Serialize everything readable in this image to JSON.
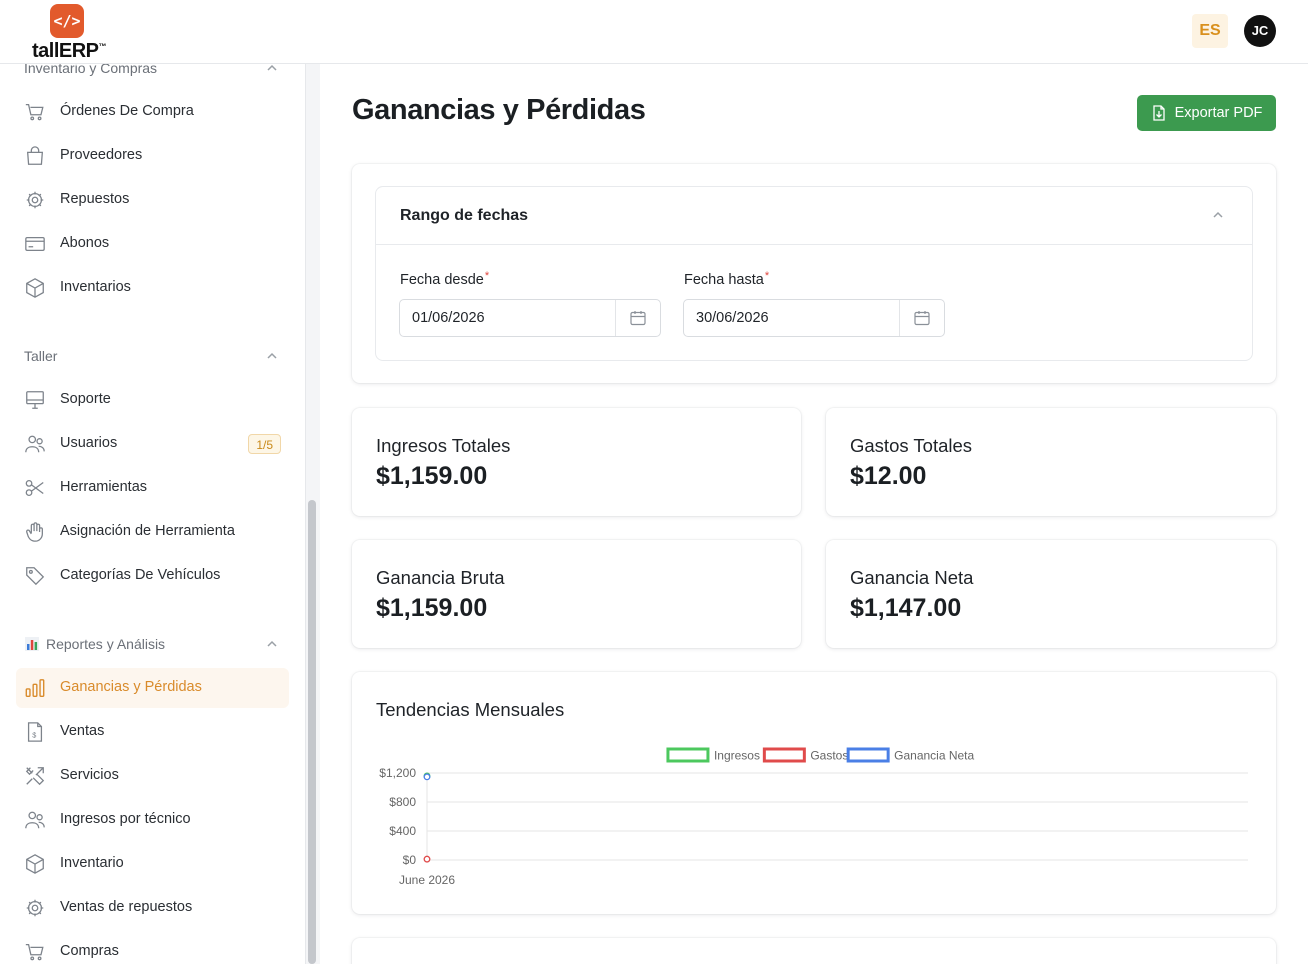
{
  "app": {
    "logo_text": "tallERP",
    "logo_tm": "™",
    "logo_mark": "</>",
    "language": "ES",
    "user_initials": "JC"
  },
  "sidebar": {
    "sections": [
      {
        "title": "Inventario y Compras",
        "items": [
          {
            "label": "Órdenes De Compra",
            "icon": "cart-icon"
          },
          {
            "label": "Proveedores",
            "icon": "shopping-bag-icon"
          },
          {
            "label": "Repuestos",
            "icon": "gear-icon"
          },
          {
            "label": "Abonos",
            "icon": "credit-card-icon"
          },
          {
            "label": "Inventarios",
            "icon": "box-icon"
          }
        ]
      },
      {
        "title": "Taller",
        "items": [
          {
            "label": "Soporte",
            "icon": "monitor-icon"
          },
          {
            "label": "Usuarios",
            "icon": "users-icon",
            "badge": "1/5"
          },
          {
            "label": "Herramientas",
            "icon": "scissors-icon"
          },
          {
            "label": "Asignación de Herramienta",
            "icon": "hand-icon"
          },
          {
            "label": "Categorías De Vehículos",
            "icon": "tag-icon"
          }
        ]
      },
      {
        "title": "Reportes y Análisis",
        "items": [
          {
            "label": "Ganancias y Pérdidas",
            "icon": "bar-chart-icon",
            "active": true
          },
          {
            "label": "Ventas",
            "icon": "invoice-icon"
          },
          {
            "label": "Servicios",
            "icon": "tools-icon"
          },
          {
            "label": "Ingresos por técnico",
            "icon": "users-icon"
          },
          {
            "label": "Inventario",
            "icon": "box-icon"
          },
          {
            "label": "Ventas de repuestos",
            "icon": "gear-icon"
          },
          {
            "label": "Compras",
            "icon": "cart-icon"
          }
        ]
      }
    ]
  },
  "main": {
    "title": "Ganancias y Pérdidas",
    "export_label": "Exportar PDF",
    "date_range": {
      "title": "Rango de fechas",
      "from_label": "Fecha desde",
      "to_label": "Fecha hasta",
      "required_mark": "*",
      "from_value": "01/06/2026",
      "to_value": "30/06/2026"
    },
    "stats": [
      {
        "label": "Ingresos Totales",
        "value": "$1,159.00"
      },
      {
        "label": "Gastos Totales",
        "value": "$12.00"
      },
      {
        "label": "Ganancia Bruta",
        "value": "$1,159.00"
      },
      {
        "label": "Ganancia Neta",
        "value": "$1,147.00"
      }
    ],
    "chart_title": "Tendencias Mensuales"
  },
  "colors": {
    "accent": "#e25a2c",
    "active_nav": "#d98b2b",
    "export_button": "#3c9a4f",
    "ingresos": "#4cc85e",
    "gastos": "#e04b4b",
    "ganancia_neta": "#4a7fe6"
  },
  "chart_data": {
    "type": "line",
    "title": "Tendencias Mensuales",
    "categories": [
      "June 2026"
    ],
    "series": [
      {
        "name": "Ingresos",
        "color": "#4cc85e",
        "values": [
          1159
        ]
      },
      {
        "name": "Gastos",
        "color": "#e04b4b",
        "values": [
          12
        ]
      },
      {
        "name": "Ganancia Neta",
        "color": "#4a7fe6",
        "values": [
          1147
        ]
      }
    ],
    "y_ticks": [
      "$1,200",
      "$800",
      "$400",
      "$0"
    ],
    "y_tick_values": [
      1200,
      800,
      400,
      0
    ],
    "ylim": [
      0,
      1200
    ],
    "xlabel": "",
    "ylabel": "",
    "legend": "top-center",
    "grid": true
  }
}
